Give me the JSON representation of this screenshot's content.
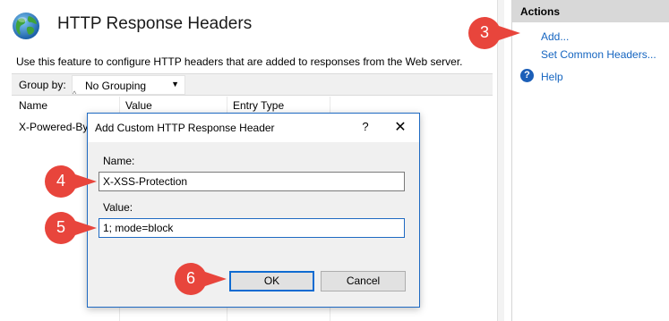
{
  "page": {
    "title": "HTTP Response Headers",
    "description": "Use this feature to configure HTTP headers that are added to responses from the Web server."
  },
  "groupbar": {
    "label": "Group by:",
    "selected": "No Grouping"
  },
  "grid": {
    "columns": [
      "Name",
      "Value",
      "Entry Type"
    ],
    "rows": [
      {
        "name": "X-Powered-By"
      }
    ]
  },
  "actions": {
    "header": "Actions",
    "items": [
      {
        "label": "Add..."
      },
      {
        "label": "Set Common Headers..."
      },
      {
        "label": "Help"
      }
    ]
  },
  "dialog": {
    "title": "Add Custom HTTP Response Header",
    "help_glyph": "?",
    "close_glyph": "✕",
    "name_label": "Name:",
    "name_value": "X-XSS-Protection",
    "value_label": "Value:",
    "value_value": "1; mode=block",
    "ok_label": "OK",
    "cancel_label": "Cancel"
  },
  "callouts": [
    "3",
    "4",
    "5",
    "6"
  ],
  "colors": {
    "accent": "#1f6ac2",
    "link": "#1565c0",
    "callout": "#e8453c",
    "actions_header": "#d8d8d8"
  },
  "icons": {
    "feature": "globe-icon",
    "help": "help-icon",
    "dropdown": "chevron-down-icon",
    "close": "close-icon"
  }
}
